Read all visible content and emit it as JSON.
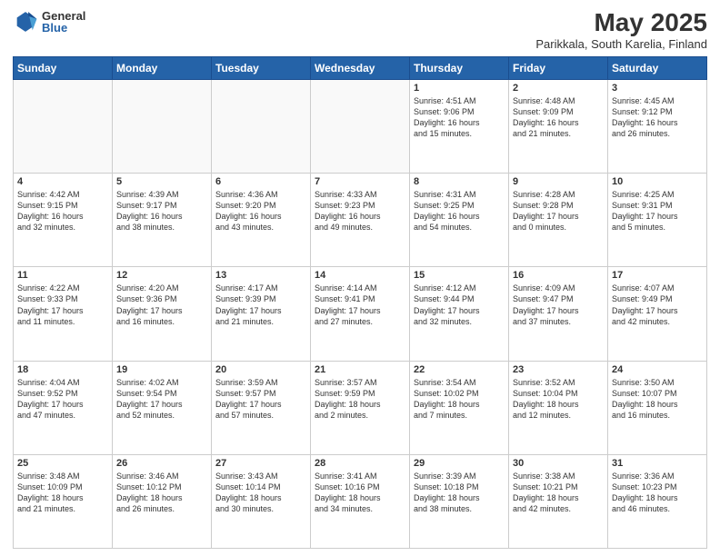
{
  "header": {
    "logo_general": "General",
    "logo_blue": "Blue",
    "title": "May 2025",
    "subtitle": "Parikkala, South Karelia, Finland"
  },
  "weekdays": [
    "Sunday",
    "Monday",
    "Tuesday",
    "Wednesday",
    "Thursday",
    "Friday",
    "Saturday"
  ],
  "weeks": [
    [
      {
        "day": "",
        "info": ""
      },
      {
        "day": "",
        "info": ""
      },
      {
        "day": "",
        "info": ""
      },
      {
        "day": "",
        "info": ""
      },
      {
        "day": "1",
        "info": "Sunrise: 4:51 AM\nSunset: 9:06 PM\nDaylight: 16 hours\nand 15 minutes."
      },
      {
        "day": "2",
        "info": "Sunrise: 4:48 AM\nSunset: 9:09 PM\nDaylight: 16 hours\nand 21 minutes."
      },
      {
        "day": "3",
        "info": "Sunrise: 4:45 AM\nSunset: 9:12 PM\nDaylight: 16 hours\nand 26 minutes."
      }
    ],
    [
      {
        "day": "4",
        "info": "Sunrise: 4:42 AM\nSunset: 9:15 PM\nDaylight: 16 hours\nand 32 minutes."
      },
      {
        "day": "5",
        "info": "Sunrise: 4:39 AM\nSunset: 9:17 PM\nDaylight: 16 hours\nand 38 minutes."
      },
      {
        "day": "6",
        "info": "Sunrise: 4:36 AM\nSunset: 9:20 PM\nDaylight: 16 hours\nand 43 minutes."
      },
      {
        "day": "7",
        "info": "Sunrise: 4:33 AM\nSunset: 9:23 PM\nDaylight: 16 hours\nand 49 minutes."
      },
      {
        "day": "8",
        "info": "Sunrise: 4:31 AM\nSunset: 9:25 PM\nDaylight: 16 hours\nand 54 minutes."
      },
      {
        "day": "9",
        "info": "Sunrise: 4:28 AM\nSunset: 9:28 PM\nDaylight: 17 hours\nand 0 minutes."
      },
      {
        "day": "10",
        "info": "Sunrise: 4:25 AM\nSunset: 9:31 PM\nDaylight: 17 hours\nand 5 minutes."
      }
    ],
    [
      {
        "day": "11",
        "info": "Sunrise: 4:22 AM\nSunset: 9:33 PM\nDaylight: 17 hours\nand 11 minutes."
      },
      {
        "day": "12",
        "info": "Sunrise: 4:20 AM\nSunset: 9:36 PM\nDaylight: 17 hours\nand 16 minutes."
      },
      {
        "day": "13",
        "info": "Sunrise: 4:17 AM\nSunset: 9:39 PM\nDaylight: 17 hours\nand 21 minutes."
      },
      {
        "day": "14",
        "info": "Sunrise: 4:14 AM\nSunset: 9:41 PM\nDaylight: 17 hours\nand 27 minutes."
      },
      {
        "day": "15",
        "info": "Sunrise: 4:12 AM\nSunset: 9:44 PM\nDaylight: 17 hours\nand 32 minutes."
      },
      {
        "day": "16",
        "info": "Sunrise: 4:09 AM\nSunset: 9:47 PM\nDaylight: 17 hours\nand 37 minutes."
      },
      {
        "day": "17",
        "info": "Sunrise: 4:07 AM\nSunset: 9:49 PM\nDaylight: 17 hours\nand 42 minutes."
      }
    ],
    [
      {
        "day": "18",
        "info": "Sunrise: 4:04 AM\nSunset: 9:52 PM\nDaylight: 17 hours\nand 47 minutes."
      },
      {
        "day": "19",
        "info": "Sunrise: 4:02 AM\nSunset: 9:54 PM\nDaylight: 17 hours\nand 52 minutes."
      },
      {
        "day": "20",
        "info": "Sunrise: 3:59 AM\nSunset: 9:57 PM\nDaylight: 17 hours\nand 57 minutes."
      },
      {
        "day": "21",
        "info": "Sunrise: 3:57 AM\nSunset: 9:59 PM\nDaylight: 18 hours\nand 2 minutes."
      },
      {
        "day": "22",
        "info": "Sunrise: 3:54 AM\nSunset: 10:02 PM\nDaylight: 18 hours\nand 7 minutes."
      },
      {
        "day": "23",
        "info": "Sunrise: 3:52 AM\nSunset: 10:04 PM\nDaylight: 18 hours\nand 12 minutes."
      },
      {
        "day": "24",
        "info": "Sunrise: 3:50 AM\nSunset: 10:07 PM\nDaylight: 18 hours\nand 16 minutes."
      }
    ],
    [
      {
        "day": "25",
        "info": "Sunrise: 3:48 AM\nSunset: 10:09 PM\nDaylight: 18 hours\nand 21 minutes."
      },
      {
        "day": "26",
        "info": "Sunrise: 3:46 AM\nSunset: 10:12 PM\nDaylight: 18 hours\nand 26 minutes."
      },
      {
        "day": "27",
        "info": "Sunrise: 3:43 AM\nSunset: 10:14 PM\nDaylight: 18 hours\nand 30 minutes."
      },
      {
        "day": "28",
        "info": "Sunrise: 3:41 AM\nSunset: 10:16 PM\nDaylight: 18 hours\nand 34 minutes."
      },
      {
        "day": "29",
        "info": "Sunrise: 3:39 AM\nSunset: 10:18 PM\nDaylight: 18 hours\nand 38 minutes."
      },
      {
        "day": "30",
        "info": "Sunrise: 3:38 AM\nSunset: 10:21 PM\nDaylight: 18 hours\nand 42 minutes."
      },
      {
        "day": "31",
        "info": "Sunrise: 3:36 AM\nSunset: 10:23 PM\nDaylight: 18 hours\nand 46 minutes."
      }
    ]
  ]
}
